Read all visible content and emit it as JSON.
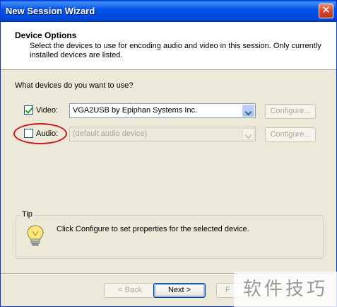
{
  "window": {
    "title": "New Session Wizard",
    "close_glyph": "✕"
  },
  "header": {
    "title": "Device Options",
    "description": "Select the devices to use for encoding audio and video in this session. Only currently installed devices are listed."
  },
  "question": "What devices do you want to use?",
  "devices": {
    "video": {
      "label": "Video:",
      "checked": true,
      "selected": "VGA2USB by Epiphan Systems Inc.",
      "configure_label": "Configure..."
    },
    "audio": {
      "label": "Audio:",
      "checked": false,
      "selected": "(default audio device)",
      "configure_label": "Configure..."
    }
  },
  "tip": {
    "legend": "Tip",
    "text": "Click Configure to set properties for the selected device.",
    "icon": "lightbulb-tip-icon"
  },
  "buttons": {
    "back": "< Back",
    "next": "Next >",
    "finish_partial": "F"
  },
  "watermark": "软件技巧",
  "colors": {
    "title_bar": "#0054e3",
    "annotation_circle": "#c8181e",
    "window_bg": "#ece9d8"
  }
}
